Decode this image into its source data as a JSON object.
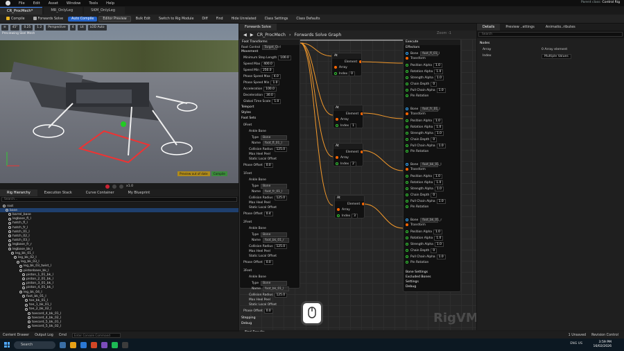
{
  "menubar": {
    "items": [
      "File",
      "Edit",
      "Asset",
      "Window",
      "Tools",
      "Help"
    ],
    "parent_class_label": "Parent class:",
    "parent_class_value": "Control Rig"
  },
  "tabs": [
    {
      "label": "CR_ProcMech*",
      "active": true
    },
    {
      "label": "MR_OnlyLeg",
      "active": false
    },
    {
      "label": "SKM_OnlyLeg",
      "active": false
    }
  ],
  "toolbar": {
    "items": [
      "Compile",
      "Forwards Solve",
      "Auto Compile",
      "Editor Preview",
      "Bulk Edit",
      "Switch to Rig Module",
      "Diff",
      "Find",
      "Hide Unrelated",
      "Class Settings",
      "Class Defaults"
    ]
  },
  "viewport": {
    "toolbar": [
      "Perspective",
      "Lit",
      "LOD Auto",
      "100",
      "45°",
      "0.25",
      "1.2",
      "4"
    ],
    "label": "Previewing Skel Mesh",
    "preview_buttons": [
      "Preview out of date",
      "Compile"
    ],
    "speed": "x1.0"
  },
  "left_tabs": [
    "Rig Hierarchy",
    "Execution Stack",
    "Curve Container",
    "My Blueprint"
  ],
  "hierarchy": {
    "search_placeholder": "Search...",
    "rows": [
      {
        "label": "root",
        "indent": 0,
        "sel": false
      },
      {
        "label": "base",
        "indent": 1,
        "sel": true
      },
      {
        "label": "barrel_base",
        "indent": 2
      },
      {
        "label": "legbase_fl_l",
        "indent": 2
      },
      {
        "label": "hatch_fl_l",
        "indent": 2
      },
      {
        "label": "hatch_fr_l",
        "indent": 2
      },
      {
        "label": "hatch_01_l",
        "indent": 2
      },
      {
        "label": "hatch_02_l",
        "indent": 2
      },
      {
        "label": "hatch_03_l",
        "indent": 2
      },
      {
        "label": "legbase_fr_r",
        "indent": 2
      },
      {
        "label": "legbase_bk_l",
        "indent": 2
      },
      {
        "label": "leg_bk_01_l",
        "indent": 3
      },
      {
        "label": "leg_bk_02_l",
        "indent": 4
      },
      {
        "label": "leg_bk_03_l",
        "indent": 5
      },
      {
        "label": "leg_bk_03_twist_l",
        "indent": 6
      },
      {
        "label": "pistonbase_bk_l",
        "indent": 6
      },
      {
        "label": "piston_1_01_bk_l",
        "indent": 7
      },
      {
        "label": "piston_2_01_bk_l",
        "indent": 7
      },
      {
        "label": "piston_3_01_bk_l",
        "indent": 7
      },
      {
        "label": "piston_4_01_bk_l",
        "indent": 7
      },
      {
        "label": "leg_bk_04_l",
        "indent": 6
      },
      {
        "label": "foot_bk_01_l",
        "indent": 7
      },
      {
        "label": "toe_bk_01_l",
        "indent": 8
      },
      {
        "label": "toe_1_bk_01_l",
        "indent": 8
      },
      {
        "label": "toe_2_bk_02_l",
        "indent": 8
      },
      {
        "label": "toecord_4_bk_01_l",
        "indent": 9
      },
      {
        "label": "toecord_4_bk_02_l",
        "indent": 9
      },
      {
        "label": "toecord_5_bk_01_l",
        "indent": 9
      },
      {
        "label": "toecord_5_bk_02_l",
        "indent": 9
      }
    ]
  },
  "graph": {
    "tab": "Forwards Solve",
    "breadcrumb": [
      "CR_ProcMech",
      "Forwards Solve Graph"
    ],
    "zoom": "Zoom -1",
    "watermark": "RigVM",
    "left_node": {
      "header": "Foot Transforms",
      "labels": {
        "root_control": "Root Control",
        "root_value": "Target_Ctrl",
        "movement": "Movement",
        "teleport": "Teleport",
        "styles": "Styles",
        "foot_sets": "Foot Sets",
        "stepping": "Stepping",
        "debug": "Debug"
      },
      "params": [
        {
          "label": "Minimum Step Length",
          "value": "100.0"
        },
        {
          "label": "Speed Max",
          "value": "400.0"
        },
        {
          "label": "Speed Min",
          "value": "250.0"
        },
        {
          "label": "Phase Speed Max",
          "value": "4.0"
        },
        {
          "label": "Phase Speed Min",
          "value": "1.0"
        },
        {
          "label": "Acceleration",
          "value": "100.0"
        },
        {
          "label": "Deceleration",
          "value": "30.0"
        },
        {
          "label": "Global Time Scale",
          "value": "1.0"
        }
      ],
      "feet": [
        {
          "index": "0",
          "name": "foot_fl_01_l",
          "radius": "125.0",
          "offset": "0.0"
        },
        {
          "index": "1",
          "name": "foot_fr_01_l",
          "radius": "125.0",
          "offset": "0.4"
        },
        {
          "index": "2",
          "name": "foot_bk_01_r",
          "radius": "125.0",
          "offset": "0.0"
        },
        {
          "index": "3",
          "name": "foot_bk_01_l",
          "radius": "125.0",
          "offset": "0.0"
        }
      ],
      "foot_labels": {
        "feet": "Feet",
        "ankle_bone": "Ankle Bone",
        "type": "Type",
        "type_value": "Bone",
        "name": "Name",
        "collision": "Collision Radius",
        "max_heel": "Max Heel Peel",
        "static_local": "Static Local Offset",
        "phase": "Phase Offset"
      }
    },
    "at_nodes": [
      {
        "header": "At",
        "element": "Element",
        "array": "Array",
        "index_label": "Index",
        "index": "0"
      },
      {
        "header": "At",
        "element": "Element",
        "array": "Array",
        "index_label": "Index",
        "index": "1"
      },
      {
        "header": "At",
        "element": "Element",
        "array": "Array",
        "index_label": "Index",
        "index": "2"
      },
      {
        "header": "At",
        "element": "Element",
        "array": "Array",
        "index_label": "Index",
        "index": "3"
      }
    ],
    "right_node": {
      "header": "Execute",
      "effectors": "Effectors",
      "labels": [
        "Bone",
        "Transform",
        "Position Alpha",
        "Rotation Alpha",
        "Strength Alpha",
        "Chain Depth",
        "Pull Chain Alpha",
        "Pin Rotation"
      ],
      "values": [
        "1.0",
        "1.0",
        "1.0",
        "0",
        "1.0",
        "1.0"
      ],
      "bone_values": [
        "foot_fl_01_l",
        "foot_fr_01_l",
        "foot_bk_01_l",
        "foot_bk_01_r"
      ],
      "footer": [
        "Bone Settings",
        "Excluded Bones",
        "Settings",
        "Debug"
      ]
    }
  },
  "details": {
    "tabs": [
      "Details",
      "Preview ..ettings",
      "Animatio..ributes"
    ],
    "search_placeholder": "Search",
    "section": "Nodes",
    "rows": [
      {
        "label": "Array",
        "value": "0 Array element"
      },
      {
        "label": "Index",
        "value": "Multiple Values"
      }
    ]
  },
  "find_bar": "Find Results",
  "statusbar": {
    "items": [
      "Content Drawer",
      "Output Log",
      "Cmd"
    ],
    "cmd_placeholder": "Enter Console Command",
    "right": [
      "1 Unsaved",
      "Revision Control"
    ]
  },
  "taskbar": {
    "search": "Search",
    "lang": "ENG US",
    "time": "3:59 PM",
    "date": "16/02/2026"
  }
}
